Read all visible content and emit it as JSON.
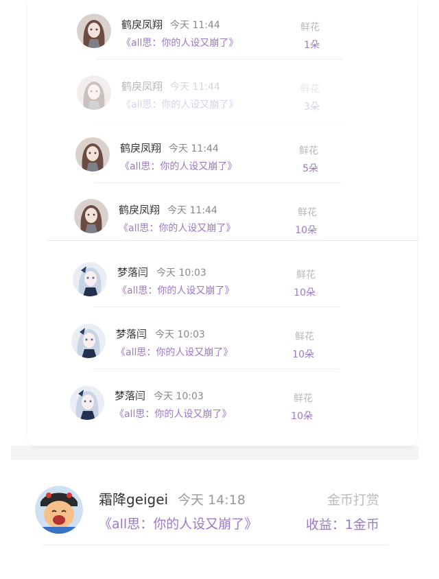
{
  "upper_list": [
    {
      "name": "鹤戾凤翔",
      "time": "今天 11:44",
      "book": "《all思：你的人设又崩了》",
      "gift": "鲜花",
      "count": "1朵",
      "avatar": "girl-brown-hair-avatar-icon"
    },
    {
      "name": "鹤戾凤翔",
      "time": "今天 11:44",
      "book": "《all思：你的人设又崩了》",
      "gift": "鲜花",
      "count": "3朵",
      "avatar": "girl-brown-hair-avatar-icon"
    },
    {
      "name": "鹤戾凤翔",
      "time": "今天 11:44",
      "book": "《all思：你的人设又崩了》",
      "gift": "鲜花",
      "count": "5朵",
      "avatar": "girl-brown-hair-avatar-icon"
    },
    {
      "name": "鹤戾凤翔",
      "time": "今天 11:44",
      "book": "《all思：你的人设又崩了》",
      "gift": "鲜花",
      "count": "10朵",
      "avatar": "girl-brown-hair-avatar-icon"
    },
    {
      "name": "梦落闫",
      "time": "今天 10:03",
      "book": "《all思：你的人设又崩了》",
      "gift": "鲜花",
      "count": "10朵",
      "avatar": "girl-white-hair-avatar-icon"
    },
    {
      "name": "梦落闫",
      "time": "今天 10:03",
      "book": "《all思：你的人设又崩了》",
      "gift": "鲜花",
      "count": "10朵",
      "avatar": "girl-white-hair-avatar-icon"
    },
    {
      "name": "梦落闫",
      "time": "今天 10:03",
      "book": "《all思：你的人设又崩了》",
      "gift": "鲜花",
      "count": "10朵",
      "avatar": "girl-white-hair-avatar-icon"
    }
  ],
  "lower_item": {
    "name": "霜降geigei",
    "time": "今天 14:18",
    "book": "《all思：你的人设又崩了》",
    "gift": "金币打赏",
    "income": "收益：1金币",
    "avatar": "cartoon-child-avatar-icon"
  },
  "colors": {
    "accent": "#9a79c8",
    "muted": "#b8b8b8",
    "text": "#333333"
  }
}
